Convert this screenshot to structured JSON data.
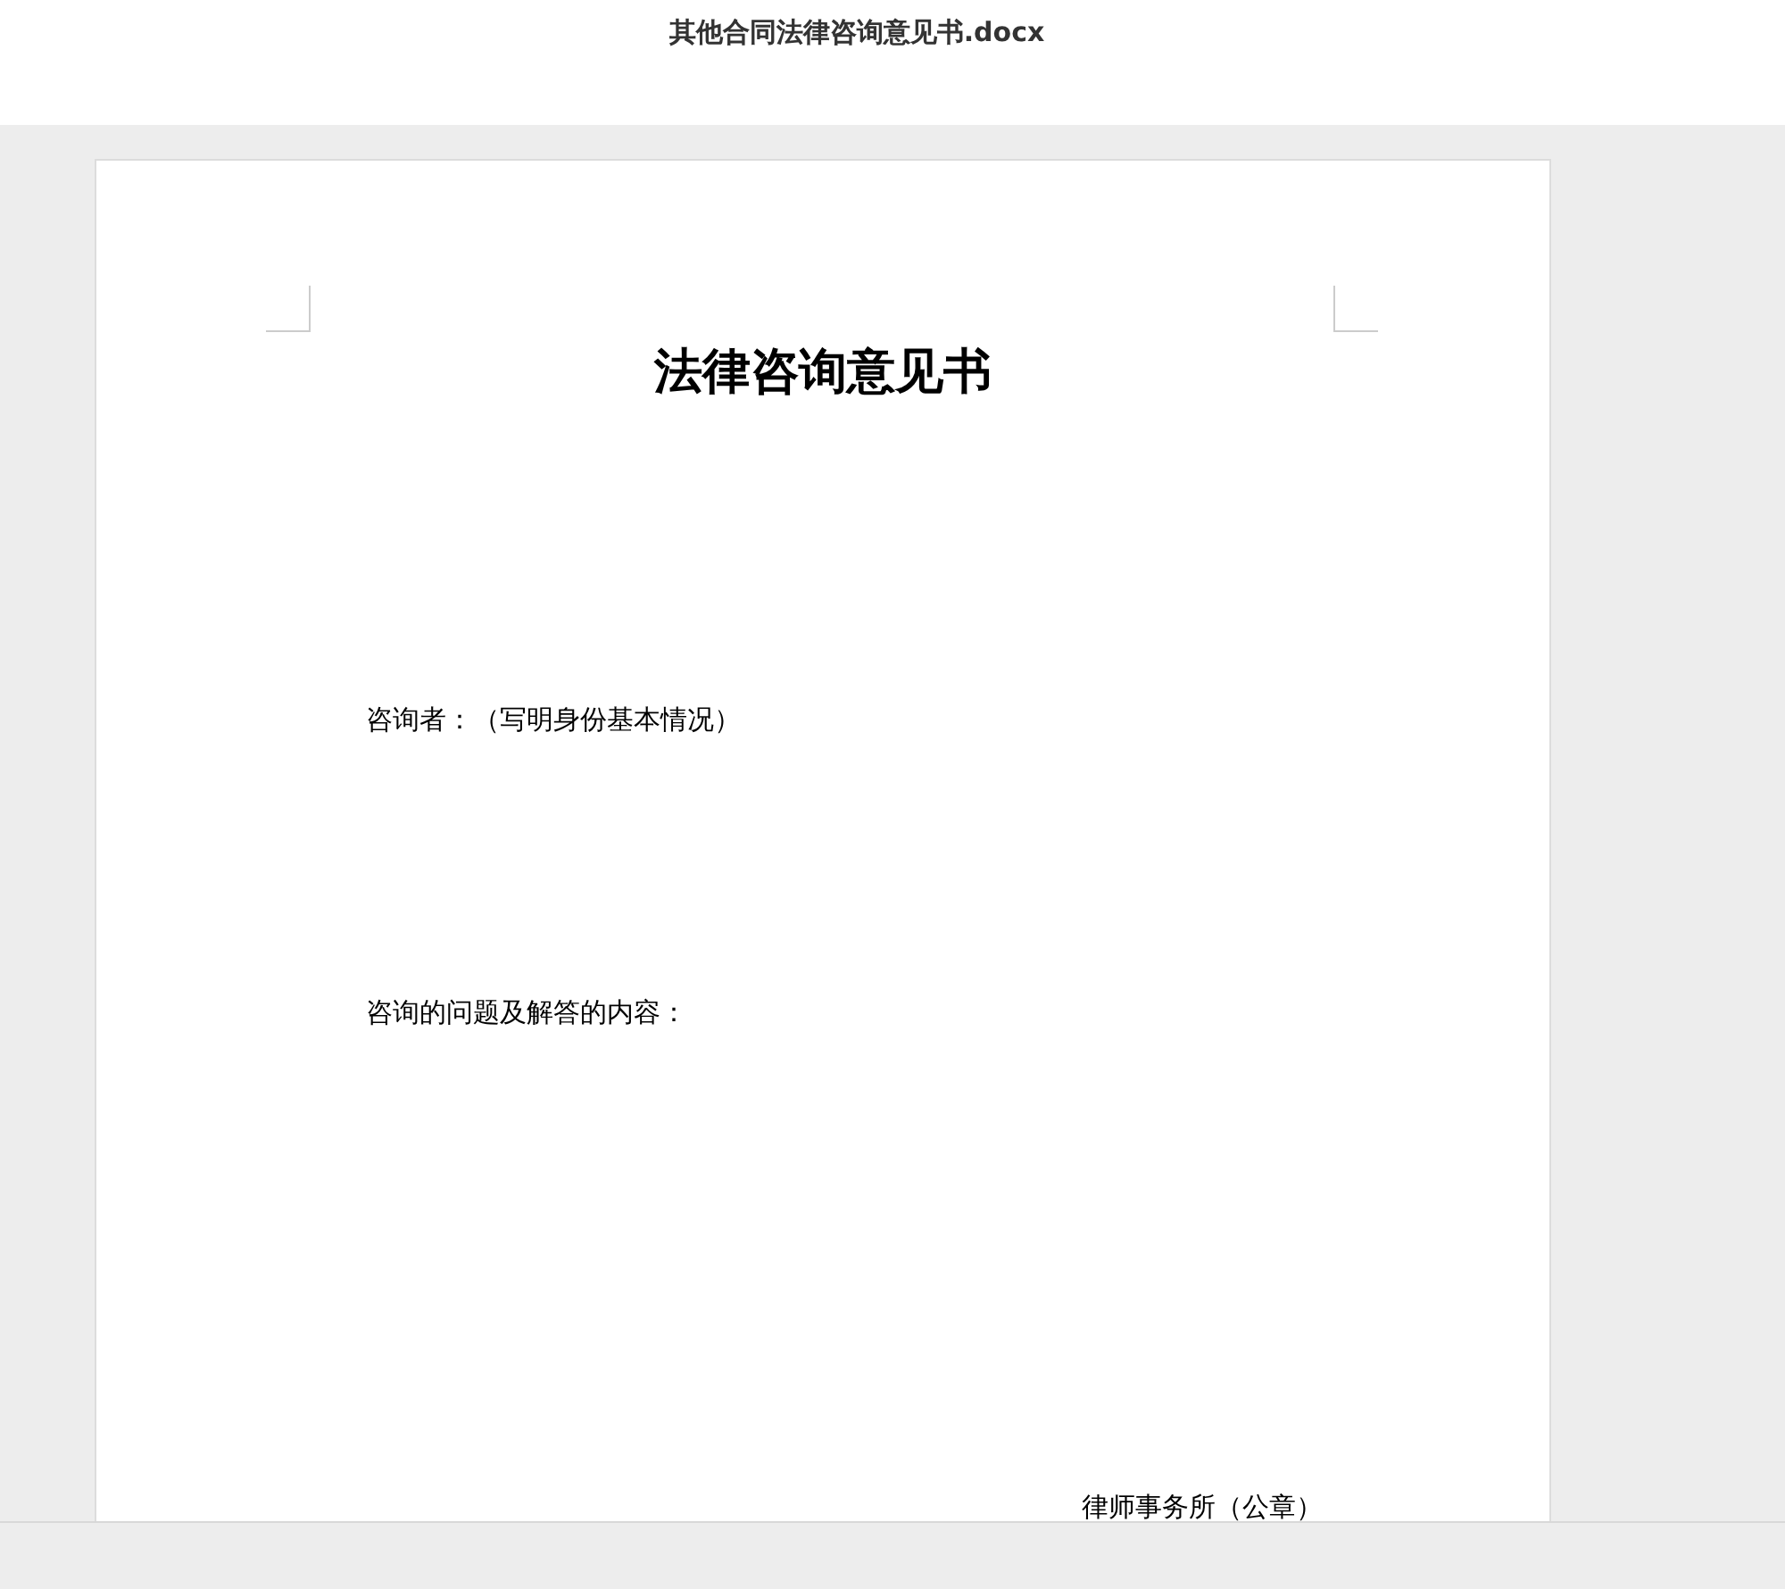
{
  "window": {
    "title": "其他合同法律咨询意见书.docx"
  },
  "document": {
    "title": "法律咨询意见书",
    "paragraphs": [
      {
        "kind": "body",
        "text": "咨询者：（写明身份基本情况）"
      },
      {
        "kind": "body",
        "text": "咨询的问题及解答的内容："
      },
      {
        "kind": "signature",
        "text": "律师事务所（公章）"
      }
    ]
  }
}
